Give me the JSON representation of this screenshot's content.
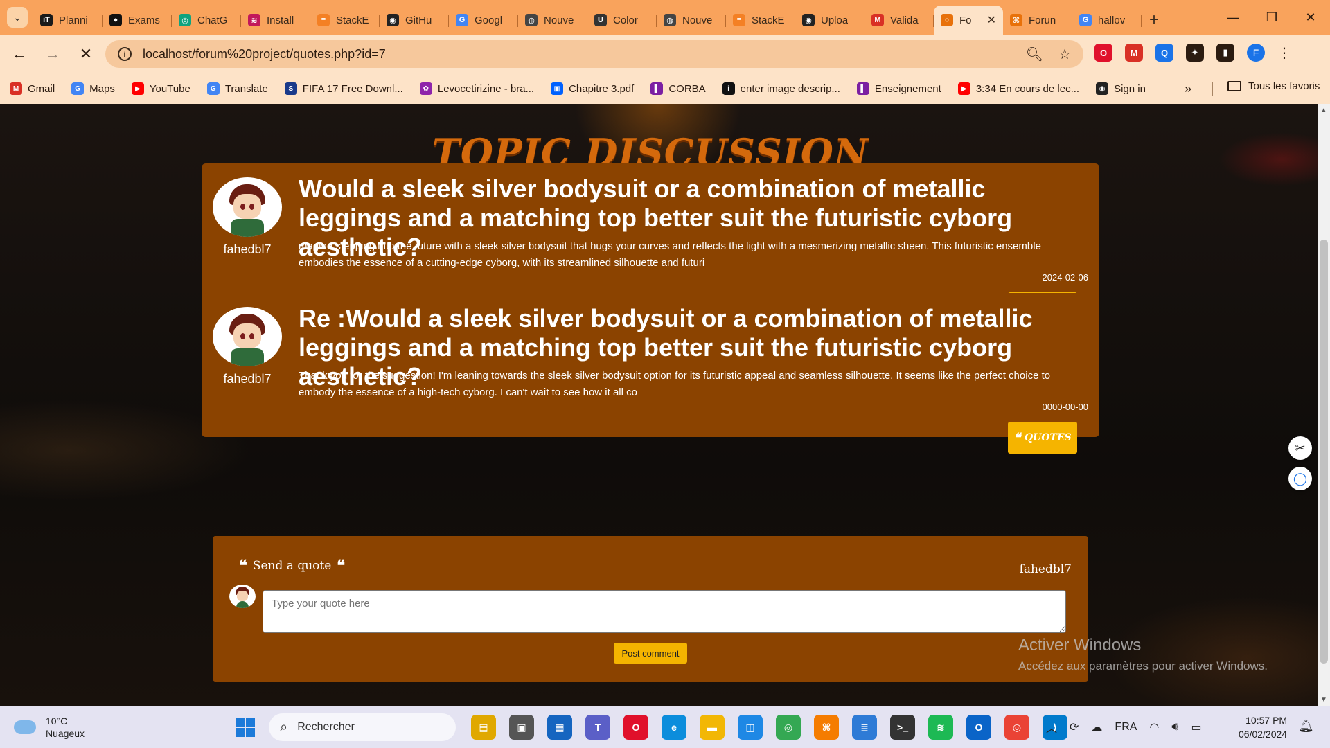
{
  "browser": {
    "tabs": [
      {
        "label": "Planni",
        "icon": "iT",
        "color": "#1a1a1a"
      },
      {
        "label": "Exams",
        "icon": "●",
        "color": "#111111"
      },
      {
        "label": "ChatG",
        "icon": "◎",
        "color": "#10a37f"
      },
      {
        "label": "Install",
        "icon": "≋",
        "color": "#c2185b"
      },
      {
        "label": "StackE",
        "icon": "≡",
        "color": "#f48024"
      },
      {
        "label": "GitHu",
        "icon": "◉",
        "color": "#222222"
      },
      {
        "label": "Googl",
        "icon": "G",
        "color": "#4285f4"
      },
      {
        "label": "Nouve",
        "icon": "◍",
        "color": "#444444"
      },
      {
        "label": "Color",
        "icon": "U",
        "color": "#333333"
      },
      {
        "label": "Nouve",
        "icon": "◍",
        "color": "#444444"
      },
      {
        "label": "StackE",
        "icon": "≡",
        "color": "#f48024"
      },
      {
        "label": "Uploa",
        "icon": "◉",
        "color": "#222222"
      },
      {
        "label": "Valida",
        "icon": "M",
        "color": "#d93025"
      },
      {
        "label": "Fo",
        "icon": "◌",
        "color": "#e8710a",
        "active": true
      },
      {
        "label": "Forun",
        "icon": "⌘",
        "color": "#e8710a"
      },
      {
        "label": "hallov",
        "icon": "G",
        "color": "#4285f4"
      }
    ],
    "url": "localhost/forum%20project/quotes.php?id=7",
    "bookmarks": [
      {
        "label": "Gmail",
        "icon": "M",
        "color": "#d93025"
      },
      {
        "label": "Maps",
        "icon": "G",
        "color": "#4285f4"
      },
      {
        "label": "YouTube",
        "icon": "▶",
        "color": "#ff0000"
      },
      {
        "label": "Translate",
        "icon": "G",
        "color": "#4285f4"
      },
      {
        "label": "FIFA 17 Free Downl...",
        "icon": "S",
        "color": "#1a3a8a"
      },
      {
        "label": "Levocetirizine - bra...",
        "icon": "✿",
        "color": "#8e24aa"
      },
      {
        "label": "Chapitre 3.pdf",
        "icon": "▣",
        "color": "#0061fe"
      },
      {
        "label": "CORBA",
        "icon": "▌",
        "color": "#7b1fa2"
      },
      {
        "label": "enter image descrip...",
        "icon": "i",
        "color": "#111111"
      },
      {
        "label": "Enseignement",
        "icon": "▌",
        "color": "#7b1fa2"
      },
      {
        "label": "3:34 En cours de lec...",
        "icon": "▶",
        "color": "#ff0000"
      },
      {
        "label": "Sign in",
        "icon": "◉",
        "color": "#222222"
      }
    ],
    "all_bookmarks": "Tous les favoris",
    "profile_initial": "F"
  },
  "page": {
    "heading": "Topic discussion",
    "posts": [
      {
        "username": "fahedbl7",
        "title": "Would a sleek silver bodysuit or a combination of metallic leggings and a matching top better suit the futuristic cyborg aesthetic?",
        "body": "magine stepping into the future with a sleek silver bodysuit that hugs your curves and reflects the light with a mesmerizing metallic sheen. This futuristic ensemble embodies the essence of a cutting-edge cyborg, with its streamlined silhouette and futuri",
        "date": "2024-02-06",
        "quote_label": "Quotes"
      },
      {
        "username": "fahedbl7",
        "title": "Re :Would a sleek silver bodysuit or a combination of metallic leggings and a matching top better suit the futuristic cyborg aesthetic?",
        "body": "Thank you for the suggestion! I'm leaning towards the sleek silver bodysuit option for its futuristic appeal and seamless silhouette. It seems like the perfect choice to embody the essence of a high-tech cyborg. I can't wait to see how it all co",
        "date": "0000-00-00",
        "quote_label": "Quotes"
      }
    ],
    "composer": {
      "heading": "Send a quote",
      "username": "fahedbl7",
      "placeholder": "Type your quote here",
      "submit_label": "Post comment"
    },
    "watermark": {
      "line1": "Activer Windows",
      "line2": "Accédez aux paramètres pour activer Windows."
    }
  },
  "taskbar": {
    "temperature": "10°C",
    "condition": "Nuageux",
    "search_placeholder": "Rechercher",
    "language": "FRA",
    "time": "10:57 PM",
    "date": "06/02/2024",
    "apps": [
      {
        "name": "file-explorer-app",
        "icon": "▤",
        "color": "#e0a800"
      },
      {
        "name": "task-view-app",
        "icon": "▣",
        "color": "#555555"
      },
      {
        "name": "store-app",
        "icon": "▦",
        "color": "#1565c0"
      },
      {
        "name": "teams-app",
        "icon": "T",
        "color": "#5b5fc7"
      },
      {
        "name": "opera-app",
        "icon": "O",
        "color": "#e0102b"
      },
      {
        "name": "edge-app",
        "icon": "e",
        "color": "#0c8ddc"
      },
      {
        "name": "folder-app",
        "icon": "▬",
        "color": "#f2b705"
      },
      {
        "name": "remote-app",
        "icon": "◫",
        "color": "#1e88e5"
      },
      {
        "name": "chrome-app",
        "icon": "◎",
        "color": "#34a853"
      },
      {
        "name": "xampp-app",
        "icon": "⌘",
        "color": "#f57c00"
      },
      {
        "name": "notepad-app",
        "icon": "≣",
        "color": "#2e7bd6"
      },
      {
        "name": "terminal-app",
        "icon": ">_",
        "color": "#333333"
      },
      {
        "name": "spotify-app",
        "icon": "≋",
        "color": "#1db954"
      },
      {
        "name": "outlook-app",
        "icon": "O",
        "color": "#0a64c8"
      },
      {
        "name": "chrome-canary-app",
        "icon": "◎",
        "color": "#ea4335"
      },
      {
        "name": "vscode-app",
        "icon": "⟩",
        "color": "#007acc"
      }
    ]
  }
}
